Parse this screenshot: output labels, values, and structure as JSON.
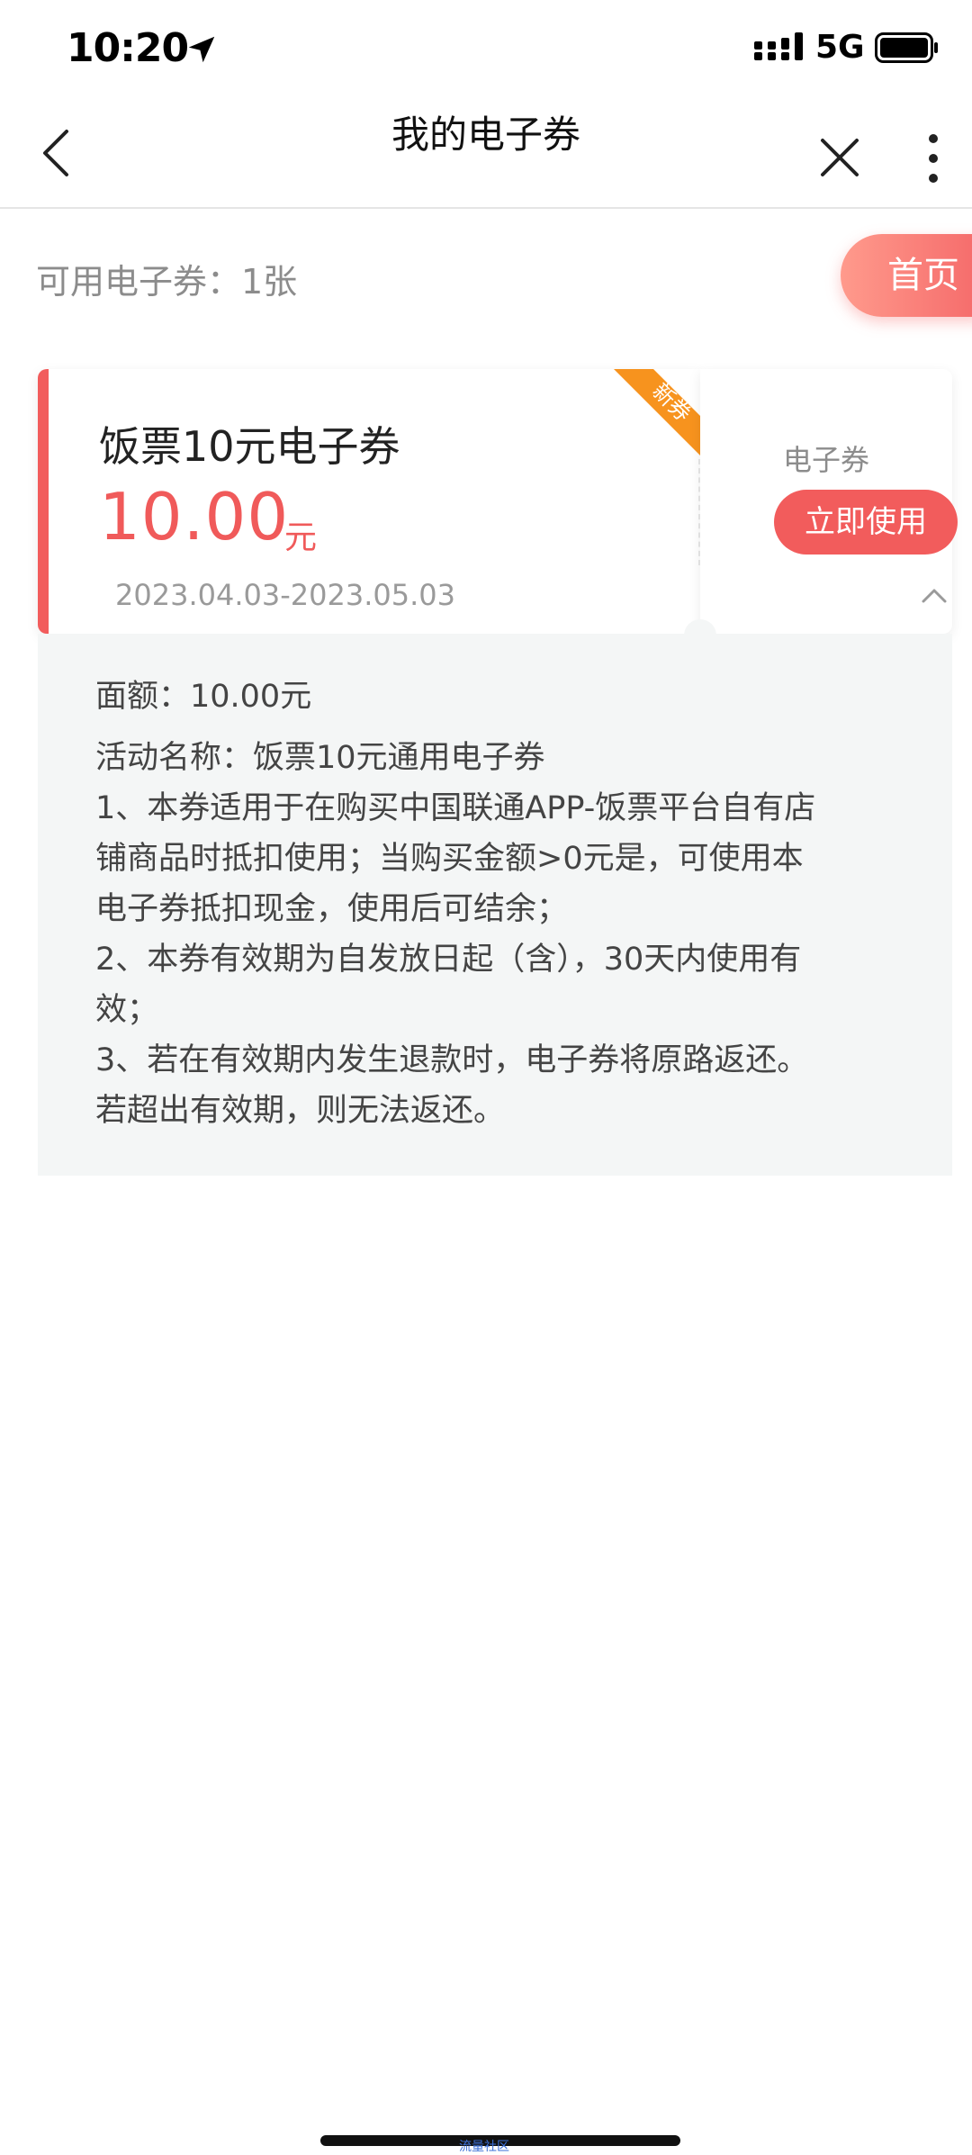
{
  "status_bar": {
    "time": "10:20",
    "network": "5G"
  },
  "nav": {
    "title": "我的电子券"
  },
  "summary": {
    "label": "可用电子券：1张",
    "home_label": "首页"
  },
  "coupon": {
    "title": "饭票10元电子券",
    "amount": "10.00",
    "unit": "元",
    "date_range": "2023.04.03-2023.05.03",
    "badge": "新券",
    "type_label": "电子券",
    "use_label": "立即使用"
  },
  "details": {
    "face_value": "面额：10.00元",
    "activity_name": "活动名称：饭票10元通用电子券",
    "rule1_line1": "1、本券适用于在购买中国联通APP-饭票平台自有店",
    "rule1_line2": "铺商品时抵扣使用；当购买金额>0元是，可使用本",
    "rule1_line3": "电子券抵扣现金，使用后可结余；",
    "rule2_line1": "2、本券有效期为自发放日起（含），30天内使用有",
    "rule2_line2": "效；",
    "rule3_line1": "3、若在有效期内发生退款时，电子券将原路返还。",
    "rule3_line2": "若超出有效期，则无法返还。"
  },
  "footer": {
    "watermark": "流量社区"
  },
  "colors": {
    "accent": "#f25c5c",
    "badge": "#f7931e",
    "panel_bg": "#f4f6f6"
  }
}
